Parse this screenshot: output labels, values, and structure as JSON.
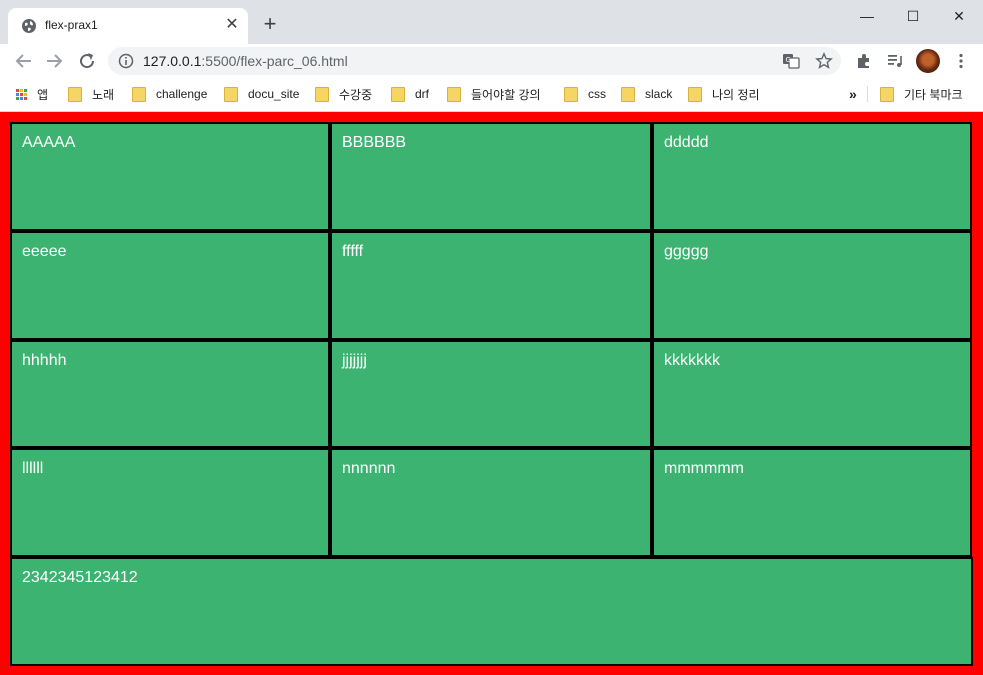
{
  "browser": {
    "tab_title": "flex-prax1",
    "tab_close": "✕",
    "new_tab": "+",
    "url_host": "127.0.0.1",
    "url_path": ":5500/flex-parc_06.html",
    "window_buttons": [
      "—",
      "☐",
      "✕"
    ]
  },
  "bookmarks": {
    "apps_label": "앱",
    "items": [
      "노래",
      "challenge",
      "docu_site",
      "수강중",
      "drf",
      "들어야할 강의",
      "css",
      "slack",
      "나의 정리"
    ],
    "overflow": "»",
    "other": "기타 북마크"
  },
  "page": {
    "background": "#ff0000",
    "box_color": "#3cb371",
    "cells": [
      "AAAAA",
      "BBBBBB",
      "ddddd",
      "eeeee",
      "fffff",
      "ggggg",
      "hhhhh",
      "jjjjjjj",
      "kkkkkkk",
      "llllll",
      "nnnnnn",
      "mmmmmm"
    ],
    "footer_cell": "2342345123412"
  },
  "icons": [
    "globe-icon",
    "close-icon",
    "plus-icon",
    "back-icon",
    "forward-icon",
    "reload-icon",
    "info-icon",
    "translate-icon",
    "star-icon",
    "extensions-icon",
    "media-icon",
    "avatar",
    "menu-icon",
    "apps-icon",
    "folder-icon"
  ]
}
